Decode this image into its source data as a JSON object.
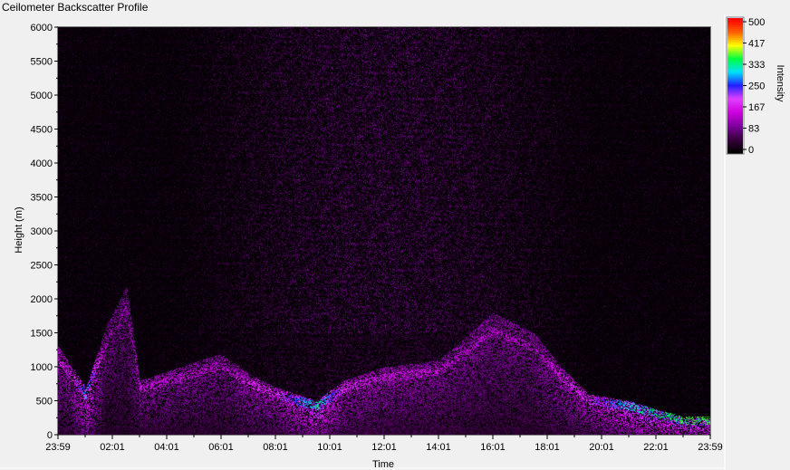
{
  "window": {
    "title": "Ceilometer Backscatter Profile"
  },
  "chart_data": {
    "type": "heatmap",
    "title": "Ceilometer Backscatter Profile",
    "xlabel": "Time",
    "ylabel": "Height (m)",
    "x_ticks": [
      "23:59",
      "02:01",
      "04:01",
      "06:01",
      "08:01",
      "10:01",
      "12:01",
      "14:01",
      "16:01",
      "18:01",
      "20:01",
      "22:01",
      "23:59"
    ],
    "y_ticks": [
      0,
      500,
      1000,
      1500,
      2000,
      2500,
      3000,
      3500,
      4000,
      4500,
      5000,
      5500,
      6000
    ],
    "ylim": [
      0,
      6000
    ],
    "colorbar": {
      "label": "Intensity",
      "ticks": [
        "500",
        "417",
        "333",
        "250",
        "167",
        "83",
        "0"
      ],
      "range": [
        0,
        500
      ]
    },
    "colormap": [
      "#000000",
      "#3a0040",
      "#8000a0",
      "#d000e0",
      "#e040ff",
      "#2020ff",
      "#00e0ff",
      "#00ff40",
      "#ffff00",
      "#ff6000",
      "#ff0000"
    ],
    "intensity_layers": [
      {
        "time": "00:00",
        "height_top_m": 1300,
        "intensity": 140
      },
      {
        "time": "00:30",
        "height_top_m": 1000,
        "intensity": 150
      },
      {
        "time": "01:00",
        "height_top_m": 700,
        "intensity": 250
      },
      {
        "time": "01:45",
        "height_top_m": 1600,
        "intensity": 110
      },
      {
        "time": "02:30",
        "height_top_m": 2200,
        "intensity": 110
      },
      {
        "time": "03:00",
        "height_top_m": 800,
        "intensity": 140
      },
      {
        "time": "06:00",
        "height_top_m": 1200,
        "intensity": 120
      },
      {
        "time": "07:00",
        "height_top_m": 900,
        "intensity": 150
      },
      {
        "time": "08:00",
        "height_top_m": 700,
        "intensity": 160
      },
      {
        "time": "09:30",
        "height_top_m": 500,
        "intensity": 280
      },
      {
        "time": "10:30",
        "height_top_m": 800,
        "intensity": 160
      },
      {
        "time": "12:00",
        "height_top_m": 1000,
        "intensity": 140
      },
      {
        "time": "14:00",
        "height_top_m": 1100,
        "intensity": 130
      },
      {
        "time": "16:00",
        "height_top_m": 1800,
        "intensity": 120
      },
      {
        "time": "17:30",
        "height_top_m": 1500,
        "intensity": 120
      },
      {
        "time": "18:30",
        "height_top_m": 1000,
        "intensity": 150
      },
      {
        "time": "19:30",
        "height_top_m": 600,
        "intensity": 170
      },
      {
        "time": "21:00",
        "height_top_m": 500,
        "intensity": 260
      },
      {
        "time": "23:00",
        "height_top_m": 250,
        "intensity": 300
      }
    ]
  }
}
